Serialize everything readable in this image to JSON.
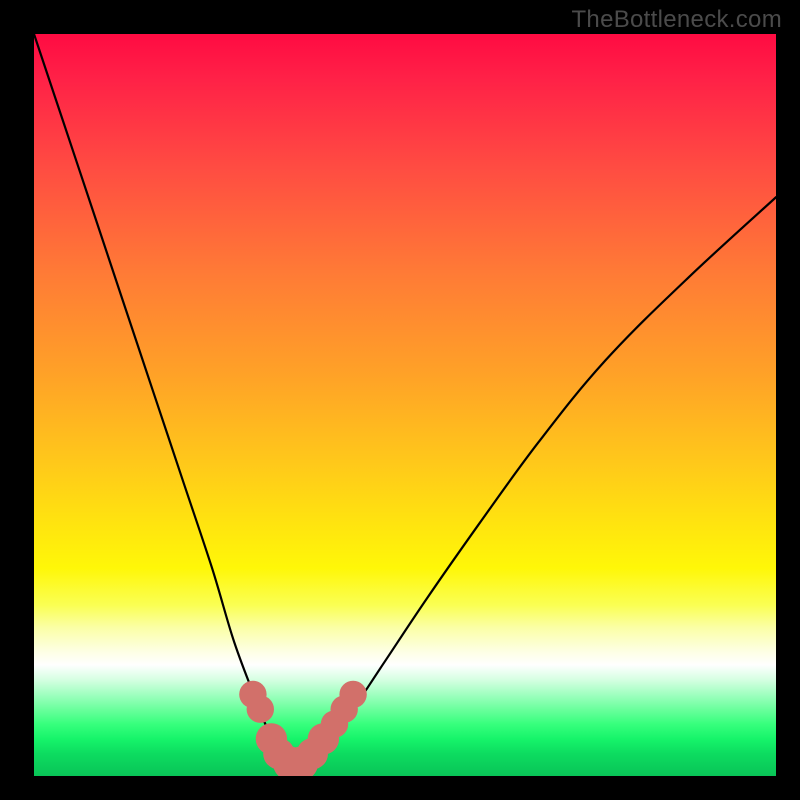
{
  "watermark": "TheBottleneck.com",
  "chart_data": {
    "type": "line",
    "title": "",
    "xlabel": "",
    "ylabel": "",
    "xlim": [
      0,
      100
    ],
    "ylim": [
      0,
      100
    ],
    "series": [
      {
        "name": "bottleneck-curve",
        "x": [
          0,
          4,
          8,
          12,
          16,
          20,
          24,
          27,
          30,
          32,
          33,
          34,
          35,
          36,
          37,
          38,
          40,
          43,
          47,
          53,
          60,
          68,
          77,
          88,
          100
        ],
        "y": [
          100,
          88,
          76,
          64,
          52,
          40,
          28,
          18,
          10,
          5,
          3,
          2,
          1.5,
          1.5,
          2,
          3,
          5,
          9,
          15,
          24,
          34,
          45,
          56,
          67,
          78
        ]
      }
    ],
    "markers": {
      "name": "highlight-points",
      "color": "#d2706a",
      "points": [
        {
          "x": 29.5,
          "y": 11,
          "r": 1.3
        },
        {
          "x": 30.5,
          "y": 9,
          "r": 1.3
        },
        {
          "x": 32.0,
          "y": 5,
          "r": 1.6
        },
        {
          "x": 33.0,
          "y": 3,
          "r": 1.6
        },
        {
          "x": 34.5,
          "y": 1.7,
          "r": 1.8
        },
        {
          "x": 36.0,
          "y": 1.7,
          "r": 1.8
        },
        {
          "x": 37.5,
          "y": 3,
          "r": 1.6
        },
        {
          "x": 39.0,
          "y": 5,
          "r": 1.6
        },
        {
          "x": 40.5,
          "y": 7,
          "r": 1.3
        },
        {
          "x": 41.8,
          "y": 9,
          "r": 1.3
        },
        {
          "x": 43.0,
          "y": 11,
          "r": 1.3
        }
      ]
    },
    "background_gradient": {
      "orientation": "vertical",
      "stops": [
        {
          "pos": 0,
          "color": "#ff0b42"
        },
        {
          "pos": 0.5,
          "color": "#ffd214"
        },
        {
          "pos": 0.85,
          "color": "#ffffff"
        },
        {
          "pos": 1.0,
          "color": "#09c457"
        }
      ]
    }
  }
}
